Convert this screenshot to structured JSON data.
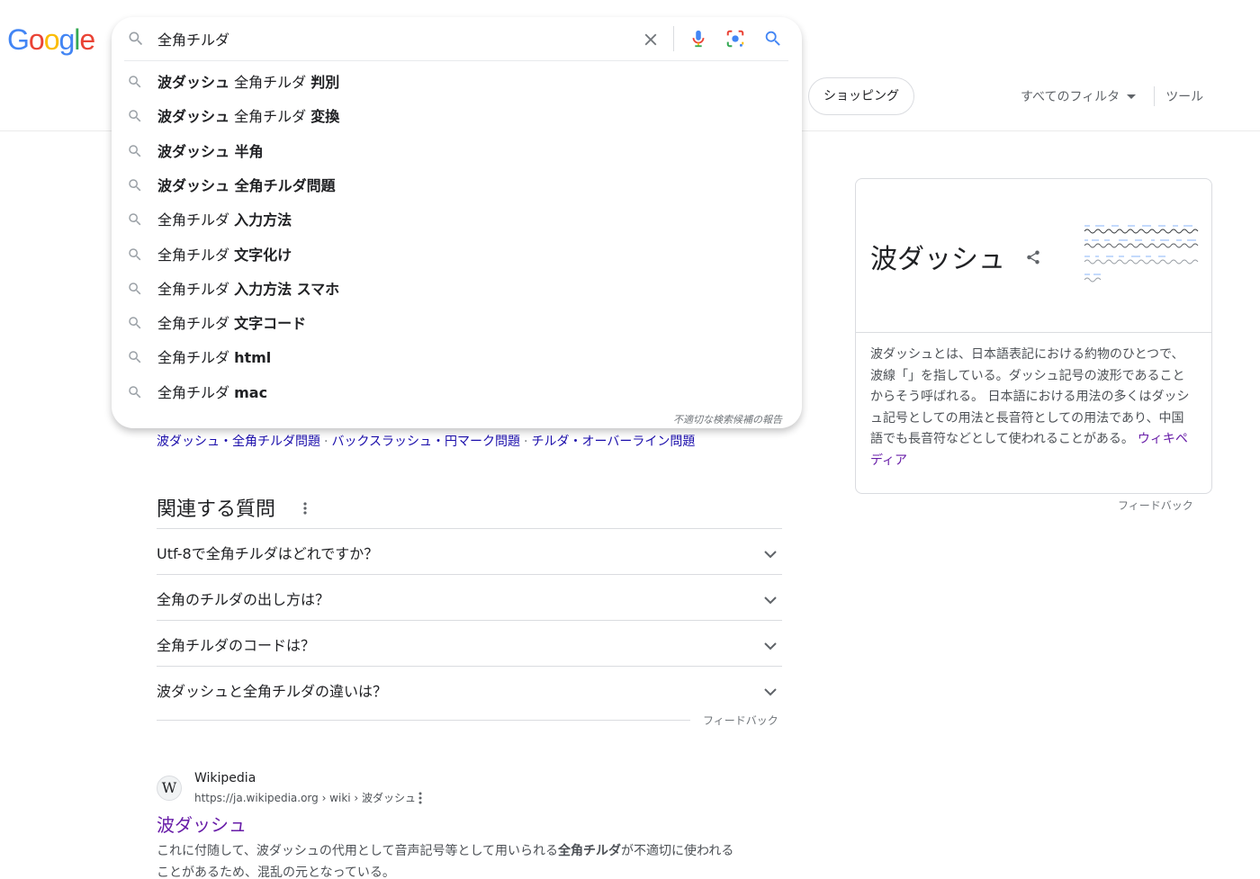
{
  "logo": {
    "letters": [
      "G",
      "o",
      "o",
      "g",
      "l",
      "e"
    ],
    "colors": [
      "#4285f4",
      "#ea4335",
      "#fbbc05",
      "#4285f4",
      "#34a853",
      "#ea4335"
    ]
  },
  "search": {
    "query": "全角チルダ",
    "suggestions": [
      {
        "bold_prefix": "波ダッシュ",
        "normal": " 全角チルダ ",
        "bold_suffix": "判別"
      },
      {
        "bold_prefix": "波ダッシュ",
        "normal": " 全角チルダ ",
        "bold_suffix": "変換"
      },
      {
        "bold_prefix": "波ダッシュ 半角",
        "normal": "",
        "bold_suffix": ""
      },
      {
        "bold_prefix": "波ダッシュ 全角チルダ問題",
        "normal": "",
        "bold_suffix": ""
      },
      {
        "bold_prefix": "",
        "normal": "全角チルダ ",
        "bold_suffix": "入力方法"
      },
      {
        "bold_prefix": "",
        "normal": "全角チルダ ",
        "bold_suffix": "文字化け"
      },
      {
        "bold_prefix": "",
        "normal": "全角チルダ ",
        "bold_suffix": "入力方法 スマホ"
      },
      {
        "bold_prefix": "",
        "normal": "全角チルダ ",
        "bold_suffix": "文字コード"
      },
      {
        "bold_prefix": "",
        "normal": "全角チルダ ",
        "bold_suffix": "html"
      },
      {
        "bold_prefix": "",
        "normal": "全角チルダ ",
        "bold_suffix": "mac"
      }
    ],
    "report_label": "不適切な検索候補の報告"
  },
  "tabs": {
    "shopping": "ショッピング",
    "all_filters": "すべてのフィルタ",
    "tools": "ツール"
  },
  "related_links": [
    "波ダッシュ・全角チルダ問題",
    "バックスラッシュ・円マーク問題",
    "チルダ・オーバーライン問題"
  ],
  "paa": {
    "title": "関連する質問",
    "questions": [
      "Utf-8で全角チルダはどれですか？",
      "全角のチルダの出し方は？",
      "全角チルダのコードは？",
      "波ダッシュと全角チルダの違いは？"
    ],
    "feedback": "フィードバック"
  },
  "result": {
    "site_name": "Wikipedia",
    "url": "https://ja.wikipedia.org › wiki › 波ダッシュ",
    "title": "波ダッシュ",
    "snippet_before": "これに付随して、波ダッシュの代用として音声記号等として用いられる",
    "snippet_bold": "全角チルダ",
    "snippet_after": "が不適切に使われることがあるため、混乱の元となっている。",
    "favicon_letter": "W"
  },
  "knowledge_panel": {
    "title": "波ダッシュ",
    "description": "波ダッシュとは、日本語表記における約物のひとつで、波線「」を指している。ダッシュ記号の波形であることからそう呼ばれる。 日本語における用法の多くはダッシュ記号としての用法と長音符としての用法であり、中国語でも長音符などとして使われることがある。",
    "source_link": "ウィキペディア",
    "feedback": "フィードバック"
  }
}
